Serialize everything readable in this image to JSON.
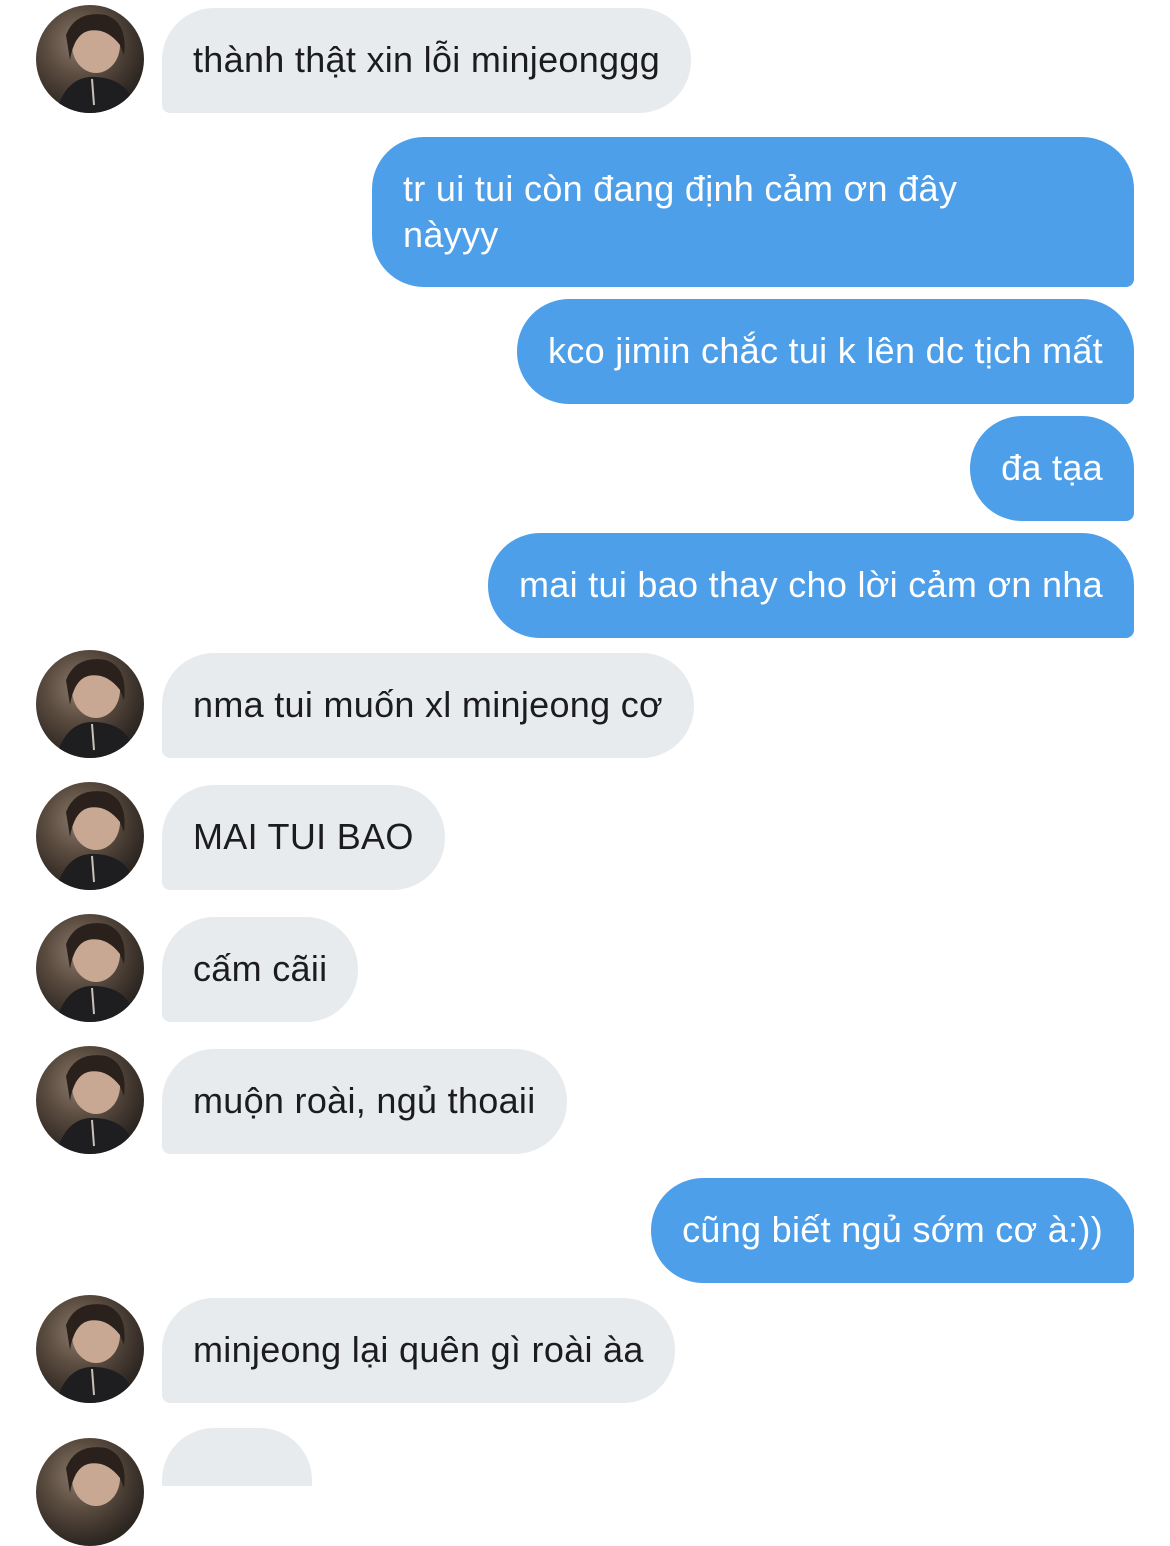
{
  "conversation": {
    "messages": [
      {
        "sender": "them",
        "text": "thành thật xin lỗi minjeonggg"
      },
      {
        "sender": "me",
        "text": "tr ui tui còn đang định cảm ơn đây\nnàyyy"
      },
      {
        "sender": "me",
        "text": "kco jimin chắc tui k lên dc tịch mất"
      },
      {
        "sender": "me",
        "text": "đa tạa"
      },
      {
        "sender": "me",
        "text": "mai tui bao thay cho lời cảm ơn nha"
      },
      {
        "sender": "them",
        "text": "nma tui muốn xl minjeong cơ"
      },
      {
        "sender": "them",
        "text": "MAI TUI BAO"
      },
      {
        "sender": "them",
        "text": "cấm cãii"
      },
      {
        "sender": "them",
        "text": "muộn roài, ngủ thoaii"
      },
      {
        "sender": "me",
        "text": "cũng biết ngủ sớm cơ à:))"
      },
      {
        "sender": "them",
        "text": "minjeong lại quên gì roài àa"
      },
      {
        "sender": "them",
        "text": ""
      }
    ]
  },
  "colors": {
    "incoming_bubble": "#e8ebed",
    "outgoing_bubble": "#4e9fea",
    "incoming_text": "#1c1c1e",
    "outgoing_text": "#ffffff"
  },
  "icons": {
    "contact_avatar": "avatar-photo"
  }
}
